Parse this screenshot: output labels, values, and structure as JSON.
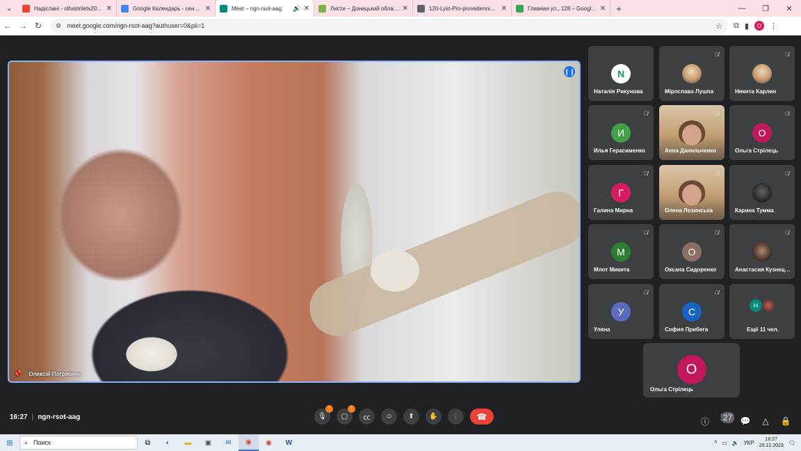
{
  "browser": {
    "tabs": [
      {
        "title": "Надіслані - olhastrilets20@gm",
        "color": "#ea4335"
      },
      {
        "title": "Google Календарь - сентябрь",
        "color": "#4285f4"
      },
      {
        "title": "Meet – ngn-rsot-aag",
        "color": "#00897b",
        "active": true
      },
      {
        "title": "Листи – Донецький обласний",
        "color": "#7cb342"
      },
      {
        "title": "120-Lyst-Pro-provedennia-obl",
        "color": "#5f6368"
      },
      {
        "title": "Главная ул., 128 – Google Карт",
        "color": "#34a853"
      }
    ],
    "url": "meet.google.com/ngn-rsot-aag?authuser=0&pli=1",
    "profile_initial": "O"
  },
  "main_video": {
    "name": "Олексій Погребняк"
  },
  "participants": [
    {
      "name": "Наталія Рикунова",
      "initial": "N",
      "color": "#ffffff",
      "text_color": "#0f9d58",
      "muted": false
    },
    {
      "name": "Мірослава Лушпа",
      "initial": "",
      "color": "photo",
      "muted": true
    },
    {
      "name": "Никита Карлин",
      "initial": "",
      "color": "photo",
      "muted": true
    },
    {
      "name": "Илья Герасименко",
      "initial": "И",
      "color": "#43a047",
      "muted": true
    },
    {
      "name": "Анна Данильченко",
      "initial": "",
      "color": "video",
      "muted": true
    },
    {
      "name": "Ольга Стрілець",
      "initial": "О",
      "color": "#c2185b",
      "muted": true
    },
    {
      "name": "Галина Мирна",
      "initial": "Г",
      "color": "#d81b60",
      "muted": true
    },
    {
      "name": "Олена Лозинська",
      "initial": "",
      "color": "video",
      "muted": true
    },
    {
      "name": "Карина Тумма",
      "initial": "",
      "color": "photo-dark",
      "muted": true
    },
    {
      "name": "Млот Микита",
      "initial": "М",
      "color": "#2e7d32",
      "muted": true
    },
    {
      "name": "Оксана Сидоренко",
      "initial": "О",
      "color": "#8d6e63",
      "muted": true
    },
    {
      "name": "Анастасия Кузнецова",
      "initial": "",
      "color": "photo-brown",
      "muted": true
    },
    {
      "name": "Уляна",
      "initial": "У",
      "color": "#5c6bc0",
      "muted": true
    },
    {
      "name": "София Прибега",
      "initial": "С",
      "color": "#1565c0",
      "muted": true
    }
  ],
  "more_tile": {
    "label": "Ещё 11 чел.",
    "initial": "Н"
  },
  "presenter_tile": {
    "name": "Ольга Стрілець",
    "initial": "О"
  },
  "bottom": {
    "time": "16:27",
    "meeting_code": "ngn-rsot-aag",
    "people_count": "27",
    "warn_mark": "!"
  },
  "taskbar": {
    "search_placeholder": "Поиск",
    "lang": "УКР",
    "clock_time": "16:27",
    "clock_date": "28.12.2023"
  }
}
